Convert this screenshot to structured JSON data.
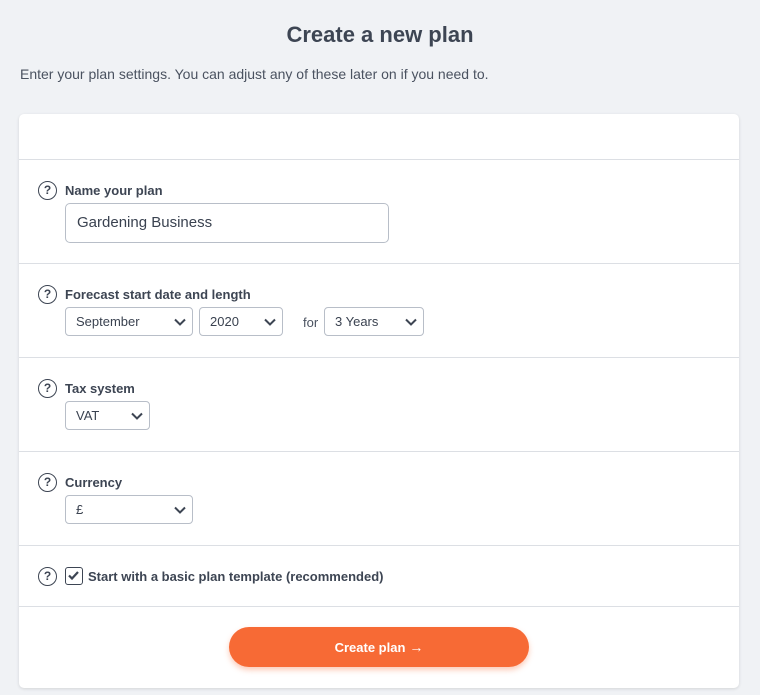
{
  "header": {
    "title": "Create a new plan",
    "subtitle": "Enter your plan settings. You can adjust any of these later on if you need to."
  },
  "form": {
    "help_glyph": "?",
    "name": {
      "label": "Name your plan",
      "value": "Gardening Business"
    },
    "forecast": {
      "label": "Forecast start date and length",
      "month": "September",
      "year": "2020",
      "for_text": "for",
      "length": "3 Years"
    },
    "tax": {
      "label": "Tax system",
      "value": "VAT"
    },
    "currency": {
      "label": "Currency",
      "value": "£"
    },
    "template": {
      "label": "Start with a basic plan template (recommended)",
      "checked": true
    },
    "submit": {
      "label": "Create plan",
      "arrow": "→"
    }
  },
  "colors": {
    "accent": "#f76a35",
    "background": "#f0f2f5",
    "text": "#3d4553"
  },
  "icons": [
    "help-icon",
    "chevron-down-icon",
    "checkmark-icon",
    "arrow-right-icon"
  ]
}
